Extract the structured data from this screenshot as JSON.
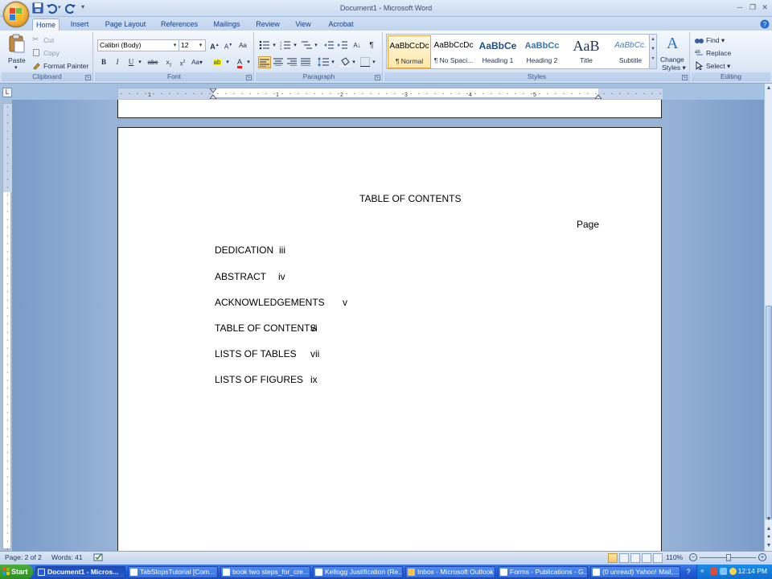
{
  "window": {
    "title": "Document1 - Microsoft Word"
  },
  "ribbon_tabs": [
    "Home",
    "Insert",
    "Page Layout",
    "References",
    "Mailings",
    "Review",
    "View",
    "Acrobat"
  ],
  "clipboard": {
    "paste": "Paste",
    "cut": "Cut",
    "copy": "Copy",
    "format_painter": "Format Painter",
    "label": "Clipboard"
  },
  "font": {
    "name": "Calibri (Body)",
    "size": "12",
    "label": "Font"
  },
  "paragraph": {
    "label": "Paragraph"
  },
  "styles": {
    "label": "Styles",
    "items": [
      {
        "sample": "AaBbCcDc",
        "name": "¶ Normal"
      },
      {
        "sample": "AaBbCcDc",
        "name": "¶ No Spaci..."
      },
      {
        "sample": "AaBbCе",
        "name": "Heading 1"
      },
      {
        "sample": "AaBbCc",
        "name": "Heading 2"
      },
      {
        "sample": "AaB",
        "name": "Title"
      },
      {
        "sample": "AaBbCc.",
        "name": "Subtitle"
      }
    ],
    "change_styles_1": "Change",
    "change_styles_2": "Styles"
  },
  "editing": {
    "find": "Find",
    "replace": "Replace",
    "select": "Select",
    "label": "Editing"
  },
  "document": {
    "heading": "TABLE OF CONTENTS",
    "page_label": "Page",
    "entries": [
      {
        "title": "DEDICATION",
        "page": "iii"
      },
      {
        "title": "ABSTRACT",
        "page": "iv"
      },
      {
        "title": "ACKNOWLEDGEMENTS",
        "page": "v"
      },
      {
        "title": "TABLE OF CONTENTS",
        "page": "vi"
      },
      {
        "title": "LISTS OF TABLES",
        "page": "vii"
      },
      {
        "title": "LISTS OF FIGURES",
        "page": "ix"
      }
    ]
  },
  "status": {
    "page": "Page: 2 of 2",
    "words": "Words: 41",
    "zoom": "110%"
  },
  "taskbar": {
    "start": "Start",
    "items": [
      "Document1 - Micros...",
      "TabStopsTutorial [Com...",
      "book two steps_for_cre...",
      "Kellogg Justification (Re...",
      "Inbox - Microsoft Outlook",
      "Forms - Publications - G...",
      "(0 unread) Yahoo! Mail,..."
    ],
    "clock": "12:14 PM"
  },
  "colors": {
    "ribbon_bg": "#dde8f6",
    "title_bg": "#c8d9f0",
    "taskbar": "#245edb",
    "start_button": "#2f8d25"
  }
}
